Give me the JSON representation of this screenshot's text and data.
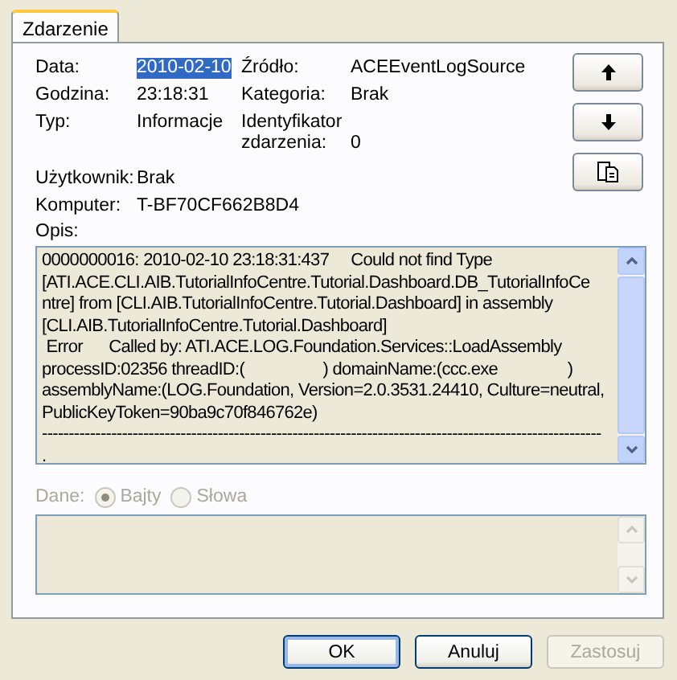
{
  "tabs": [
    {
      "label": "Zdarzenie",
      "selected": true
    }
  ],
  "fields": [
    {
      "label": "Data:",
      "value": "2010-02-10",
      "selected": true
    },
    {
      "label": "Źródło:",
      "value": "ACEEventLogSource",
      "selected": false
    },
    {
      "label": "Godzina:",
      "value": "23:18:31",
      "selected": false
    },
    {
      "label": "Kategoria:",
      "value": "Brak",
      "selected": false
    },
    {
      "label": "Typ:",
      "value": "Informacje",
      "selected": false
    },
    {
      "label": "Identyfikator zdarzenia:",
      "value": "0",
      "selected": false
    }
  ],
  "wide_fields": [
    {
      "label": "Użytkownik:",
      "value": "Brak"
    },
    {
      "label": "Komputer:",
      "value": "T-BF70CF662B8D4"
    }
  ],
  "side_buttons": [
    {
      "kind": "up"
    },
    {
      "kind": "down"
    },
    {
      "kind": "copy"
    }
  ],
  "description": {
    "label": "Opis:",
    "lines": [
      "0000000016: 2010-02-10 23:18:31:437     Could not find Type",
      "[ATI.ACE.CLI.AIB.TutorialInfoCentre.Tutorial.Dashboard.DB_TutorialInfoCe",
      "ntre] from [CLI.AIB.TutorialInfoCentre.Tutorial.Dashboard] in assembly",
      "[CLI.AIB.TutorialInfoCentre.Tutorial.Dashboard]",
      " Error      Called by: ATI.ACE.LOG.Foundation.Services::LoadAssembly",
      "processID:02356 threadID:(                  ) domainName:(ccc.exe                ) ",
      "assemblyName:(LOG.Foundation, Version=2.0.3531.24410, Culture=neutral,",
      "PublicKeyToken=90ba9c70f846762e)",
      "---------------------------------------------------------------------------------------------------------",
      "."
    ]
  },
  "data": {
    "label": "Dane:",
    "disabled": true,
    "options": [
      {
        "label": "Bajty",
        "selected": true
      },
      {
        "label": "Słowa",
        "selected": false
      }
    ]
  },
  "buttons": [
    {
      "label": "OK",
      "disabled": false,
      "default": true
    },
    {
      "label": "Anuluj",
      "disabled": false,
      "default": false
    },
    {
      "label": "Zastosuj",
      "disabled": true,
      "default": false
    }
  ]
}
